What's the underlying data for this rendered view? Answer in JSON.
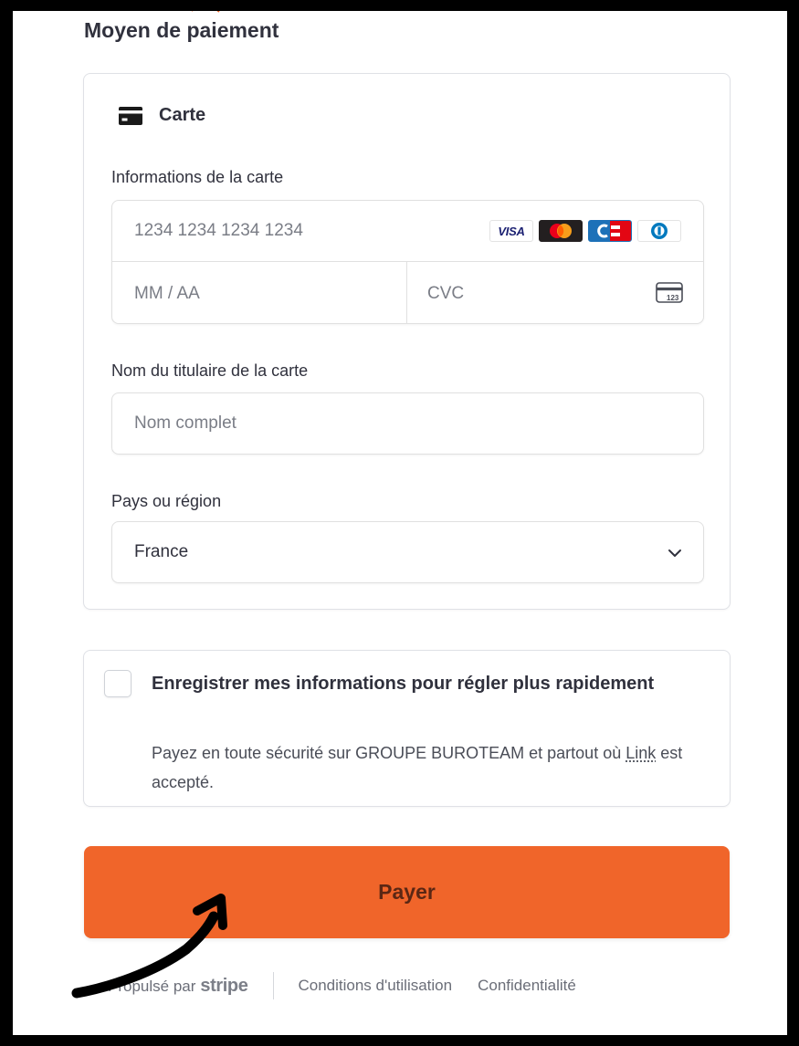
{
  "payment": {
    "section_title": "Moyen de paiement",
    "method": {
      "label": "Carte",
      "icon": "credit-card-icon"
    },
    "card_info": {
      "label": "Informations de la carte",
      "number_placeholder": "1234 1234 1234 1234",
      "expiry_placeholder": "MM / AA",
      "cvc_placeholder": "CVC",
      "brands": [
        {
          "name": "Visa",
          "text": "VISA",
          "color": "#1a1f71"
        },
        {
          "name": "Mastercard",
          "colors": [
            "#eb001b",
            "#f79e1b"
          ]
        },
        {
          "name": "Cartes Bancaires",
          "colors": [
            "#1d71b8",
            "#e30613"
          ]
        },
        {
          "name": "Diners Club",
          "color": "#0079be"
        }
      ],
      "cvc_icon_text": "123"
    },
    "cardholder": {
      "label": "Nom du titulaire de la carte",
      "placeholder": "Nom complet"
    },
    "country": {
      "label": "Pays ou région",
      "value": "France"
    }
  },
  "save_info": {
    "checked": false,
    "title": "Enregistrer mes informations pour régler plus rapidement",
    "desc_before": "Payez en toute sécurité sur GROUPE BUROTEAM et partout où ",
    "link_text": "Link",
    "desc_after": " est accepté."
  },
  "pay_button": {
    "label": "Payer",
    "color": "#f0652a"
  },
  "footer": {
    "powered_by": "Propulsé par",
    "brand": "stripe",
    "links": [
      "Conditions d'utilisation",
      "Confidentialité"
    ]
  },
  "colors": {
    "frame": "#000000",
    "accent": "#f0652a",
    "text": "#30313d",
    "placeholder": "#7a7d86"
  }
}
